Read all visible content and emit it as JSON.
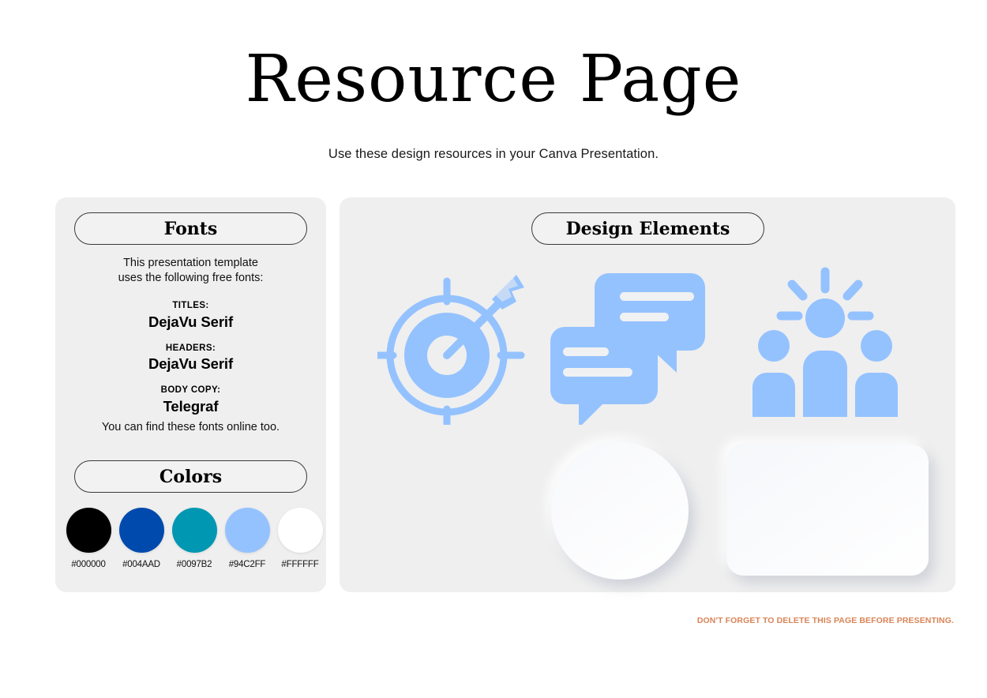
{
  "header": {
    "title": "Resource Page",
    "subtitle": "Use these design resources in your Canva Presentation."
  },
  "fonts_panel": {
    "pill_label": "Fonts",
    "intro_line1": "This presentation template",
    "intro_line2": "uses the following free fonts:",
    "specs": [
      {
        "label": "TITLES:",
        "name": "DejaVu Serif"
      },
      {
        "label": "HEADERS:",
        "name": "DejaVu Serif"
      },
      {
        "label": "BODY COPY:",
        "name": "Telegraf"
      }
    ],
    "outro": "You can find these fonts online too."
  },
  "colors_panel": {
    "pill_label": "Colors",
    "swatches": [
      {
        "hex": "#000000",
        "label": "#000000"
      },
      {
        "hex": "#004AAD",
        "label": "#004AAD"
      },
      {
        "hex": "#0097B2",
        "label": "#0097B2"
      },
      {
        "hex": "#94C2FF",
        "label": "#94C2FF"
      },
      {
        "hex": "#FFFFFF",
        "label": "#FFFFFF"
      }
    ]
  },
  "design_panel": {
    "pill_label": "Design Elements",
    "icon_color": "#94C2FF",
    "icons": [
      {
        "name": "target-arrow-icon"
      },
      {
        "name": "speech-bubbles-icon"
      },
      {
        "name": "team-leadership-icon"
      }
    ],
    "shapes": [
      {
        "name": "circle-placeholder"
      },
      {
        "name": "rounded-rectangle-placeholder"
      }
    ]
  },
  "footer": {
    "note": "DON'T FORGET TO DELETE THIS PAGE BEFORE PRESENTING.",
    "note_color": "#D98457"
  }
}
